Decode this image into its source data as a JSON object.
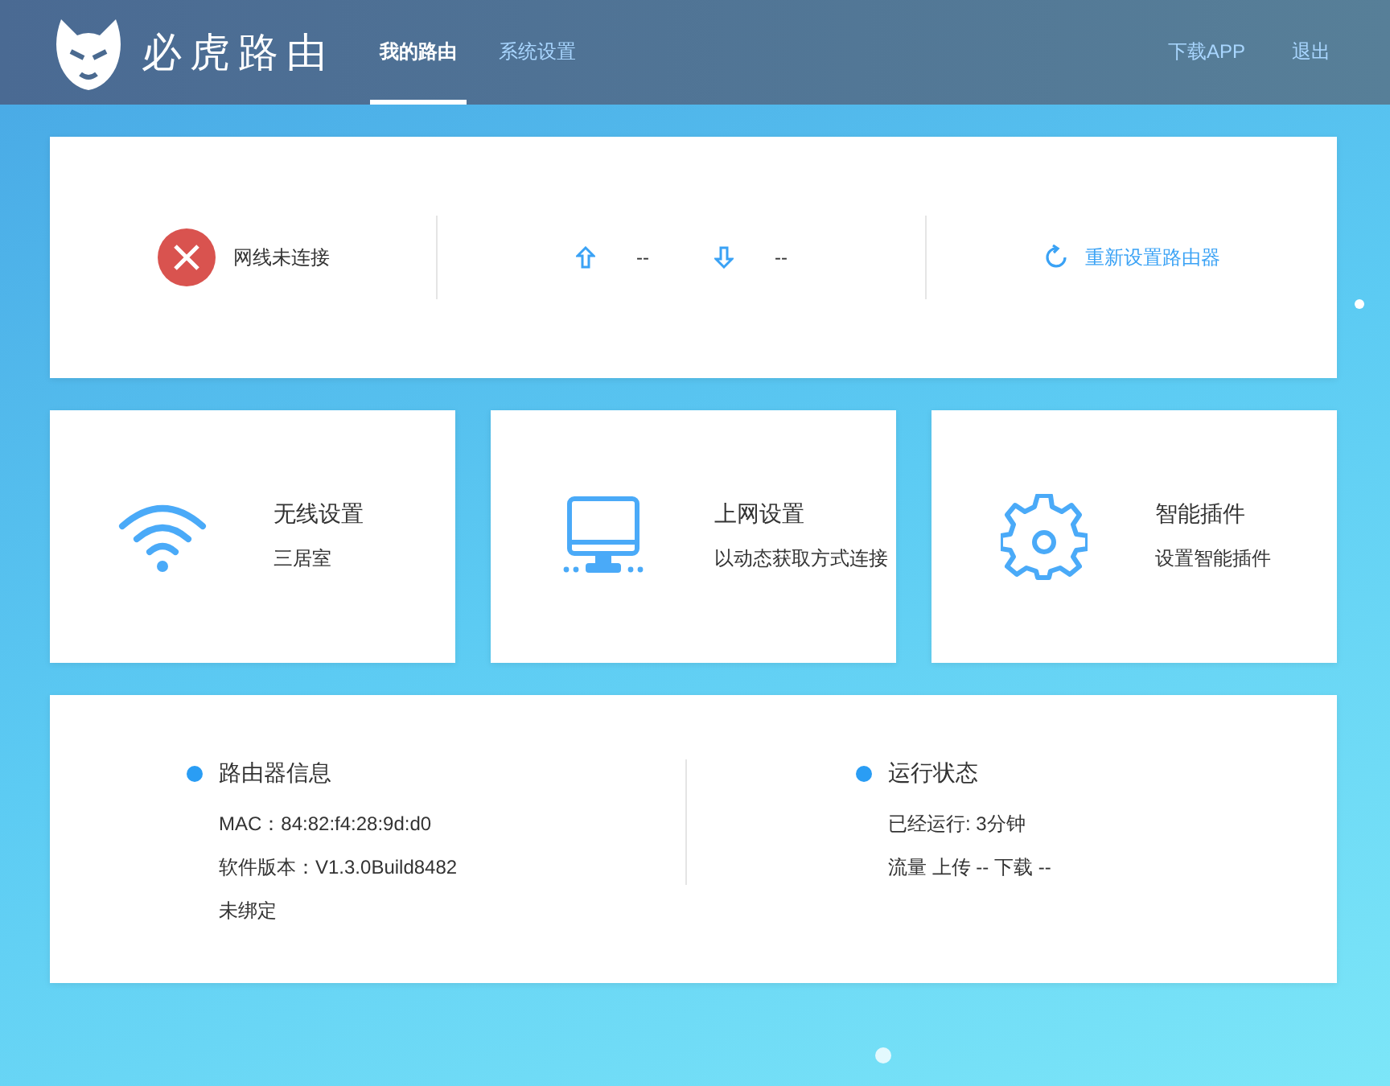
{
  "header": {
    "brand": "必虎路由",
    "tabs": [
      {
        "label": "我的路由",
        "selected": true
      },
      {
        "label": "系统设置",
        "selected": false
      }
    ],
    "links": [
      "下载APP",
      "退出"
    ]
  },
  "status": {
    "connected": false,
    "connection_text": "网线未连接",
    "upload": "--",
    "download": "--",
    "reset_label": "重新设置路由器"
  },
  "tiles": [
    {
      "kind": "wifi",
      "title": "无线设置",
      "subtitle": "三居室"
    },
    {
      "kind": "monitor",
      "title": "上网设置",
      "subtitle": "以动态获取方式连接"
    },
    {
      "kind": "gear",
      "title": "智能插件",
      "subtitle": "设置智能插件"
    }
  ],
  "info": [
    {
      "title": "路由器信息",
      "lines": [
        "MAC：84:82:f4:28:9d:d0",
        "软件版本：V1.3.0Build8482",
        "未绑定"
      ]
    },
    {
      "title": "运行状态",
      "lines": [
        "已经运行: 3分钟",
        "流量 上传 -- 下载 --"
      ]
    }
  ]
}
